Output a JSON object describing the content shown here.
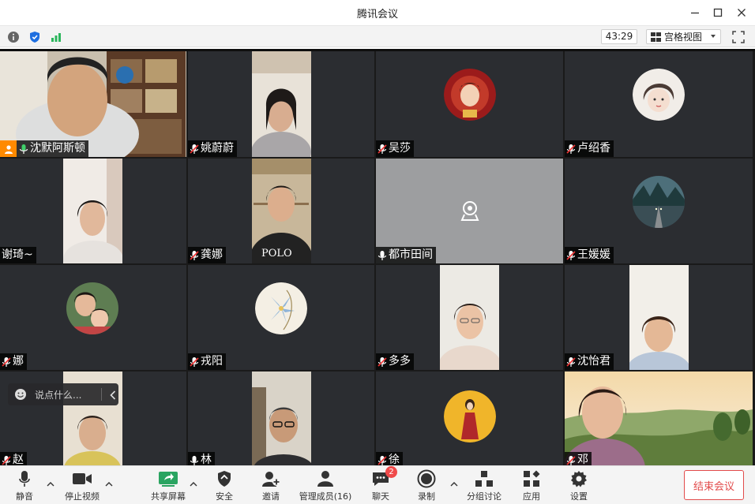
{
  "window": {
    "title": "腾讯会议"
  },
  "toolbar": {
    "timer": "43:29",
    "view_mode": "宫格视图"
  },
  "participants": [
    {
      "name": "沈默阿斯顿",
      "mic": "on",
      "host": true
    },
    {
      "name": "姚蔚蔚",
      "mic": "muted"
    },
    {
      "name": "吴莎",
      "mic": "muted"
    },
    {
      "name": "卢绍香",
      "mic": "muted"
    },
    {
      "name": "谢琦~",
      "mic": "none"
    },
    {
      "name": "龚娜",
      "mic": "muted"
    },
    {
      "name": "都市田间",
      "mic": "on"
    },
    {
      "name": "王媛媛",
      "mic": "muted"
    },
    {
      "name": "娜",
      "mic": "muted"
    },
    {
      "name": "戎阳",
      "mic": "muted"
    },
    {
      "name": "多多",
      "mic": "muted"
    },
    {
      "name": "沈怡君",
      "mic": "muted"
    },
    {
      "name": "赵",
      "mic": "muted"
    },
    {
      "name": "林",
      "mic": "on"
    },
    {
      "name": "徐",
      "mic": "muted"
    },
    {
      "name": "邓",
      "mic": "muted"
    }
  ],
  "chat_input": {
    "placeholder": "说点什么..."
  },
  "bottombar": {
    "mute": "静音",
    "stop_video": "停止视频",
    "share_screen": "共享屏幕",
    "security": "安全",
    "invite": "邀请",
    "manage_members": "管理成员(16)",
    "chat": "聊天",
    "chat_badge": "2",
    "record": "录制",
    "breakout": "分组讨论",
    "apps": "应用",
    "settings": "设置",
    "end_meeting": "结束会议"
  }
}
